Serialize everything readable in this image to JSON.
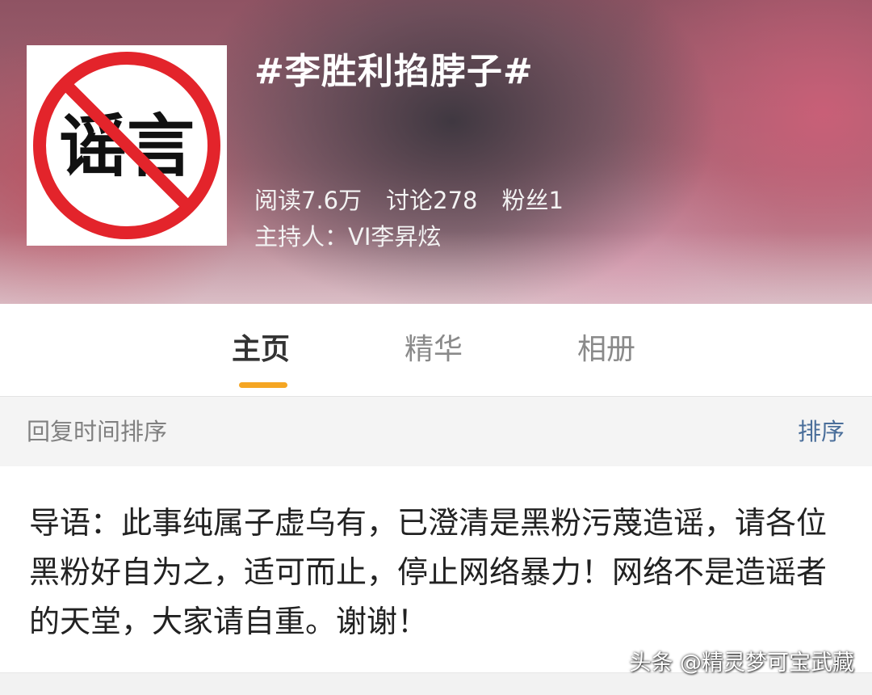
{
  "header": {
    "avatar": {
      "icon": "no-rumor-sign-icon",
      "text": "谣言",
      "sign_color": "#e3242b"
    },
    "title": "#李胜利掐脖子#",
    "stats": {
      "reads": "阅读7.6万",
      "discussions": "讨论278",
      "fans": "粉丝1"
    },
    "host": "主持人：VI李昇炫"
  },
  "tabs": [
    {
      "label": "主页",
      "active": true
    },
    {
      "label": "精华",
      "active": false
    },
    {
      "label": "相册",
      "active": false
    }
  ],
  "sortbar": {
    "label": "回复时间排序",
    "button": "排序"
  },
  "content": {
    "intro": "导语：此事纯属子虚乌有，已澄清是黑粉污蔑造谣，请各位黑粉好自为之，适可而止，停止网络暴力！网络不是造谣者的天堂，大家请自重。谢谢！"
  },
  "watermark": "头条 @精灵梦可宝武藏",
  "colors": {
    "accent": "#f5a623",
    "link": "#4a6e9a"
  }
}
